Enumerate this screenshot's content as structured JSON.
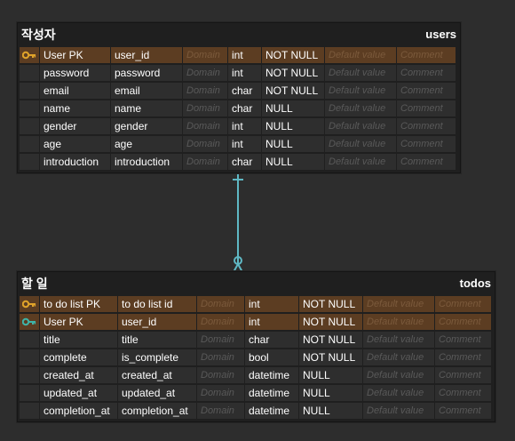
{
  "users": {
    "logical_name": "작성자",
    "physical_name": "users",
    "columns": [
      {
        "key": "primary",
        "logical": "User PK",
        "physical": "user_id",
        "domain": "Domain",
        "type": "int",
        "nullable": "NOT NULL",
        "default": "Default value",
        "comment": "Comment"
      },
      {
        "key": "",
        "logical": "password",
        "physical": "password",
        "domain": "Domain",
        "type": "int",
        "nullable": "NOT NULL",
        "default": "Default value",
        "comment": "Comment"
      },
      {
        "key": "",
        "logical": "email",
        "physical": "email",
        "domain": "Domain",
        "type": "char",
        "nullable": "NOT NULL",
        "default": "Default value",
        "comment": "Comment"
      },
      {
        "key": "",
        "logical": "name",
        "physical": "name",
        "domain": "Domain",
        "type": "char",
        "nullable": "NULL",
        "default": "Default value",
        "comment": "Comment"
      },
      {
        "key": "",
        "logical": "gender",
        "physical": "gender",
        "domain": "Domain",
        "type": "int",
        "nullable": "NULL",
        "default": "Default value",
        "comment": "Comment"
      },
      {
        "key": "",
        "logical": "age",
        "physical": "age",
        "domain": "Domain",
        "type": "int",
        "nullable": "NULL",
        "default": "Default value",
        "comment": "Comment"
      },
      {
        "key": "",
        "logical": "introduction",
        "physical": "introduction",
        "domain": "Domain",
        "type": "char",
        "nullable": "NULL",
        "default": "Default value",
        "comment": "Comment"
      }
    ]
  },
  "todos": {
    "logical_name": "할 일",
    "physical_name": "todos",
    "columns": [
      {
        "key": "primary",
        "logical": "to do list PK",
        "physical": "to do list id",
        "domain": "Domain",
        "type": "int",
        "nullable": "NOT NULL",
        "default": "Default value",
        "comment": "Comment"
      },
      {
        "key": "foreign",
        "logical": "User PK",
        "physical": "user_id",
        "domain": "Domain",
        "type": "int",
        "nullable": "NOT NULL",
        "default": "Default value",
        "comment": "Comment"
      },
      {
        "key": "",
        "logical": "title",
        "physical": "title",
        "domain": "Domain",
        "type": "char",
        "nullable": "NOT NULL",
        "default": "Default value",
        "comment": "Comment"
      },
      {
        "key": "",
        "logical": "complete",
        "physical": "is_complete",
        "domain": "Domain",
        "type": "bool",
        "nullable": "NOT NULL",
        "default": "Default value",
        "comment": "Comment"
      },
      {
        "key": "",
        "logical": "created_at",
        "physical": "created_at",
        "domain": "Domain",
        "type": "datetime",
        "nullable": "NULL",
        "default": "Default value",
        "comment": "Comment"
      },
      {
        "key": "",
        "logical": "updated_at",
        "physical": "updated_at",
        "domain": "Domain",
        "type": "datetime",
        "nullable": "NULL",
        "default": "Default value",
        "comment": "Comment"
      },
      {
        "key": "",
        "logical": "completion_at",
        "physical": "completion_at",
        "domain": "Domain",
        "type": "datetime",
        "nullable": "NULL",
        "default": "Default value",
        "comment": "Comment"
      }
    ]
  },
  "relationship": {
    "from": "users",
    "to": "todos",
    "cardinality": "one-to-zero-or-many",
    "color": "#5fb8c4"
  },
  "colors": {
    "canvas": "#2d2d2d",
    "table": "#1f1f1f",
    "cell": "#2e2e2e",
    "pk_row": "#5c3d22",
    "primary_key_icon": "#e0a32a",
    "foreign_key_icon": "#3fb4a8"
  }
}
